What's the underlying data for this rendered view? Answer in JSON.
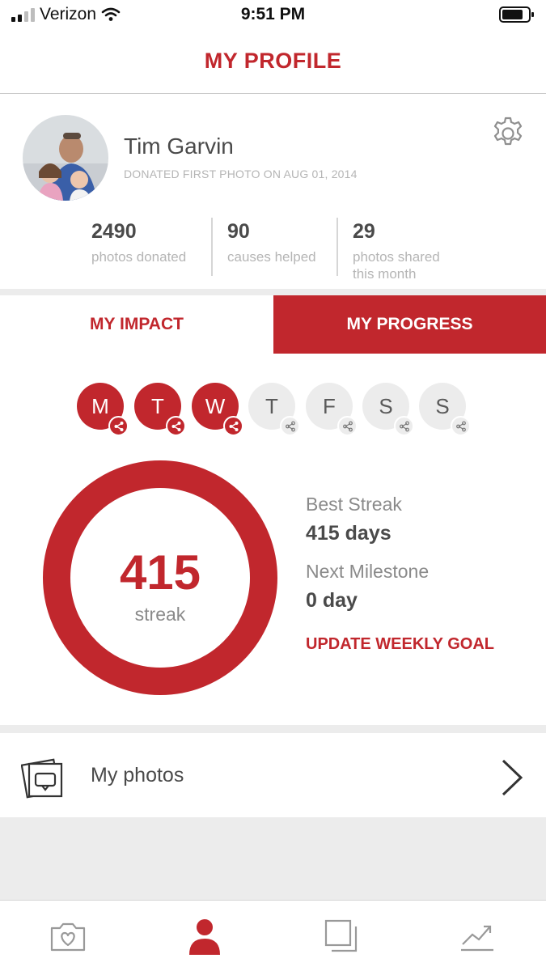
{
  "status_bar": {
    "carrier": "Verizon",
    "time": "9:51 PM"
  },
  "header": {
    "title": "MY PROFILE"
  },
  "profile": {
    "name": "Tim Garvin",
    "donated_since": "DONATED FIRST PHOTO ON AUG 01, 2014",
    "stats": [
      {
        "value": "2490",
        "label_line1": "photos donated",
        "label_line2": ""
      },
      {
        "value": "90",
        "label_line1": "causes helped",
        "label_line2": ""
      },
      {
        "value": "29",
        "label_line1": "photos shared",
        "label_line2": "this month"
      }
    ]
  },
  "tabs": [
    {
      "label": "MY IMPACT",
      "active": false
    },
    {
      "label": "MY PROGRESS",
      "active": true
    }
  ],
  "week": [
    {
      "letter": "M",
      "shared": true
    },
    {
      "letter": "T",
      "shared": true
    },
    {
      "letter": "W",
      "shared": true
    },
    {
      "letter": "T",
      "shared": false
    },
    {
      "letter": "F",
      "shared": false
    },
    {
      "letter": "S",
      "shared": false
    },
    {
      "letter": "S",
      "shared": false
    }
  ],
  "streak": {
    "value": "415",
    "label": "streak",
    "best_label": "Best Streak",
    "best_value": "415 days",
    "milestone_label": "Next Milestone",
    "milestone_value": "0 day",
    "update_goal": "UPDATE WEEKLY GOAL"
  },
  "photos_row": {
    "label": "My photos"
  },
  "nav": [
    "camera-heart-icon",
    "profile-icon",
    "photos-stack-icon",
    "trend-chart-icon"
  ],
  "colors": {
    "accent": "#c1272d",
    "muted_text": "#b5b5b5",
    "body_text": "#4a4a4a",
    "inactive_day": "#ececec"
  }
}
